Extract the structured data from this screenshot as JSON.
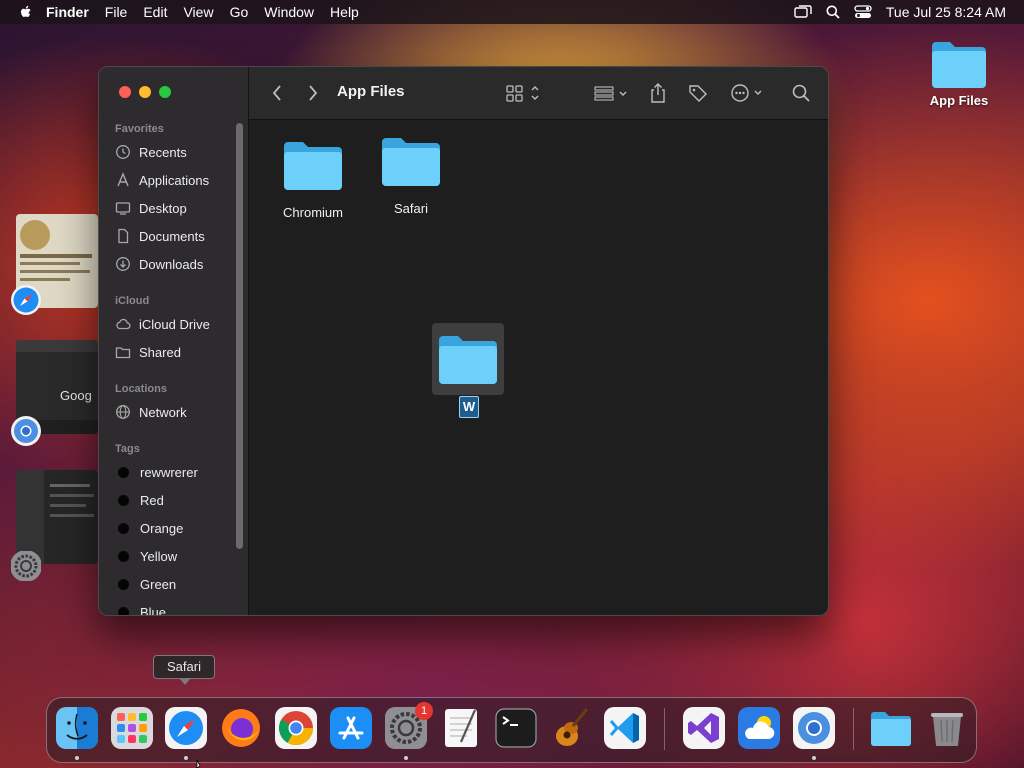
{
  "menubar": {
    "app_name": "Finder",
    "menus": [
      "File",
      "Edit",
      "View",
      "Go",
      "Window",
      "Help"
    ],
    "datetime": "Tue Jul 25  8:24 AM",
    "icons": [
      "screen-mirroring-icon",
      "search-icon",
      "control-center-icon"
    ]
  },
  "desktop": {
    "icons": [
      {
        "label": "App Files",
        "icon": "folder-icon"
      }
    ]
  },
  "stage_manager": {
    "groups": [
      {
        "app": "Safari",
        "icon": "safari-icon"
      },
      {
        "app": "Chromium",
        "icon": "chromium-icon",
        "thumb_text": "Goog"
      },
      {
        "app": "System Settings",
        "icon": "settings-icon"
      }
    ]
  },
  "finder": {
    "title": "App Files",
    "sidebar": {
      "favorites_header": "Favorites",
      "favorites": [
        "Recents",
        "Applications",
        "Desktop",
        "Documents",
        "Downloads"
      ],
      "icloud_header": "iCloud",
      "icloud": [
        "iCloud Drive",
        "Shared"
      ],
      "locations_header": "Locations",
      "locations": [
        "Network"
      ],
      "tags_header": "Tags",
      "tags": [
        "rewwrerer",
        "Red",
        "Orange",
        "Yellow",
        "Green",
        "Blue"
      ]
    },
    "files": [
      {
        "name": "Chromium",
        "icon": "folder-icon"
      },
      {
        "name": "Safari",
        "icon": "folder-icon"
      }
    ],
    "drag_item": {
      "icon": "folder-icon",
      "badge_letter": "W"
    }
  },
  "dock": {
    "tooltip": "Safari",
    "apps": [
      "Finder",
      "Launchpad",
      "Safari",
      "Firefox",
      "Chrome",
      "App Store",
      "System Settings",
      "TextEdit",
      "Terminal",
      "GarageBand",
      "Visual Studio Code",
      "Visual Studio",
      "Weather",
      "Chromium",
      "Downloads Folder",
      "Trash"
    ],
    "settings_badge": "1"
  },
  "colors": {
    "accent_folder": "#5ac8fa",
    "close": "#ff5f57",
    "minimize": "#febc2e",
    "zoom": "#28c840"
  }
}
